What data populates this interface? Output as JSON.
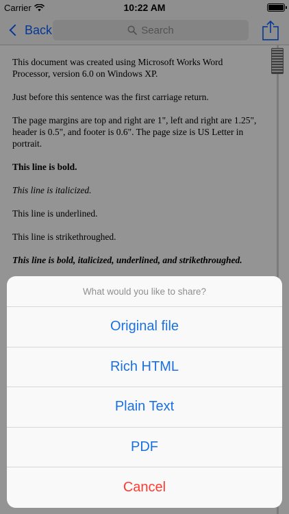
{
  "status_bar": {
    "carrier": "Carrier",
    "time": "10:22 AM"
  },
  "nav": {
    "back_label": "Back",
    "search_placeholder": "Search"
  },
  "document": {
    "paragraphs": [
      "This document was created using Microsoft Works Word Processor, version 6.0 on Windows XP.",
      "Just before this sentence was the first carriage return.",
      "The page margins are top and right are 1\", left and right are 1.25\",  header is 0.5\", and footer is 0.6\".  The page size is US Letter in portrait.",
      "This line is bold.",
      "This line is italicized.",
      "This line is underlined.",
      "This line is strikethroughed.",
      "This line is bold, italicized, underlined, and strikethroughed."
    ]
  },
  "action_sheet": {
    "title": "What would you like to share?",
    "options": [
      "Original file",
      "Rich HTML",
      "Plain Text",
      "PDF"
    ],
    "cancel": "Cancel"
  },
  "colors": {
    "accent": "#1a70e0",
    "destructive": "#ff3b30"
  },
  "icons": {
    "share": "share-icon",
    "search": "search-icon",
    "back": "chevron-left-icon"
  }
}
